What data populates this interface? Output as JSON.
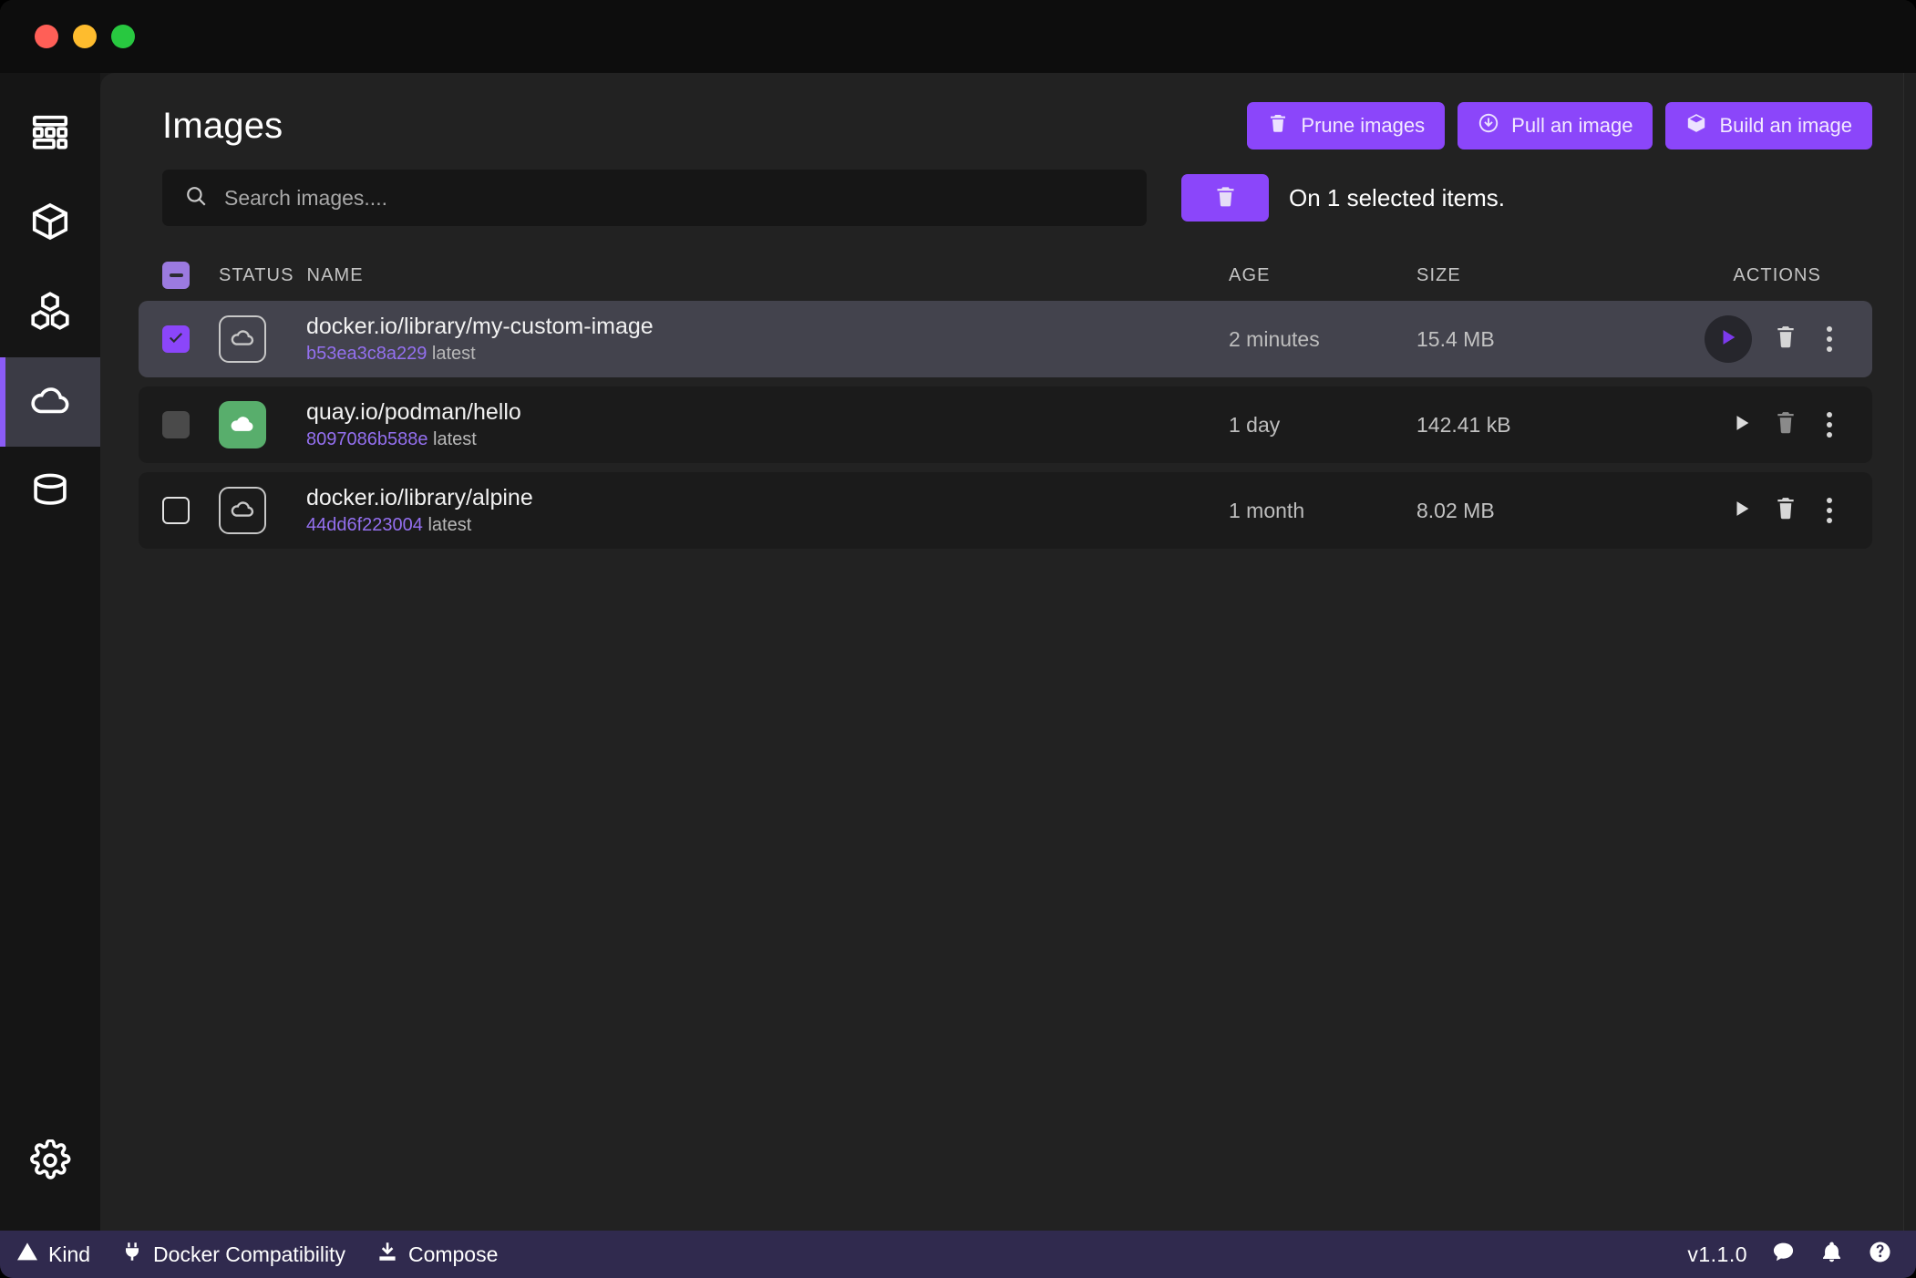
{
  "window": {
    "traffic_lights": [
      "close",
      "minimize",
      "maximize"
    ]
  },
  "sidebar": {
    "items": [
      {
        "name": "dashboard",
        "icon": "dashboard-icon",
        "active": false
      },
      {
        "name": "containers",
        "icon": "cube-icon",
        "active": false
      },
      {
        "name": "pods",
        "icon": "pods-icon",
        "active": false
      },
      {
        "name": "images",
        "icon": "cloud-icon",
        "active": true
      },
      {
        "name": "volumes",
        "icon": "database-icon",
        "active": false
      }
    ],
    "settings": {
      "name": "settings",
      "icon": "gear-icon"
    }
  },
  "header": {
    "title": "Images",
    "buttons": [
      {
        "label": "Prune images",
        "icon": "trash-icon"
      },
      {
        "label": "Pull an image",
        "icon": "download-circle-icon"
      },
      {
        "label": "Build an image",
        "icon": "cube-icon"
      }
    ],
    "accent": "#8b46fa"
  },
  "search": {
    "placeholder": "Search images....",
    "value": ""
  },
  "selection": {
    "delete_icon": "trash-icon",
    "text": "On 1 selected items."
  },
  "table": {
    "header_checkbox_state": "indeterminate",
    "columns": [
      "STATUS",
      "NAME",
      "AGE",
      "SIZE",
      "ACTIONS"
    ],
    "rows": [
      {
        "checkbox": "checked",
        "selected": true,
        "status_icon": "cloud-outline-icon",
        "status_style": "outline",
        "name": "docker.io/library/my-custom-image",
        "sha": "b53ea3c8a229",
        "tag": "latest",
        "age": "2 minutes",
        "size": "15.4 MB",
        "play_style": "circle-accent",
        "trash_style": "normal"
      },
      {
        "checkbox": "muted",
        "selected": false,
        "status_icon": "cloud-filled-icon",
        "status_style": "filled",
        "name": "quay.io/podman/hello",
        "sha": "8097086b588e",
        "tag": "latest",
        "age": "1 day",
        "size": "142.41 kB",
        "play_style": "plain",
        "trash_style": "dim"
      },
      {
        "checkbox": "unchecked",
        "selected": false,
        "status_icon": "cloud-outline-icon",
        "status_style": "outline",
        "name": "docker.io/library/alpine",
        "sha": "44dd6f223004",
        "tag": "latest",
        "age": "1 month",
        "size": "8.02 MB",
        "play_style": "plain",
        "trash_style": "normal"
      }
    ]
  },
  "statusbar": {
    "left": [
      {
        "label": "Kind",
        "icon": "warning-triangle-icon"
      },
      {
        "label": "Docker Compatibility",
        "icon": "plug-icon"
      },
      {
        "label": "Compose",
        "icon": "download-tray-icon"
      }
    ],
    "version": "v1.1.0",
    "right_icons": [
      "chat-icon",
      "bell-icon",
      "help-circle-icon"
    ],
    "background": "#302a4e"
  }
}
